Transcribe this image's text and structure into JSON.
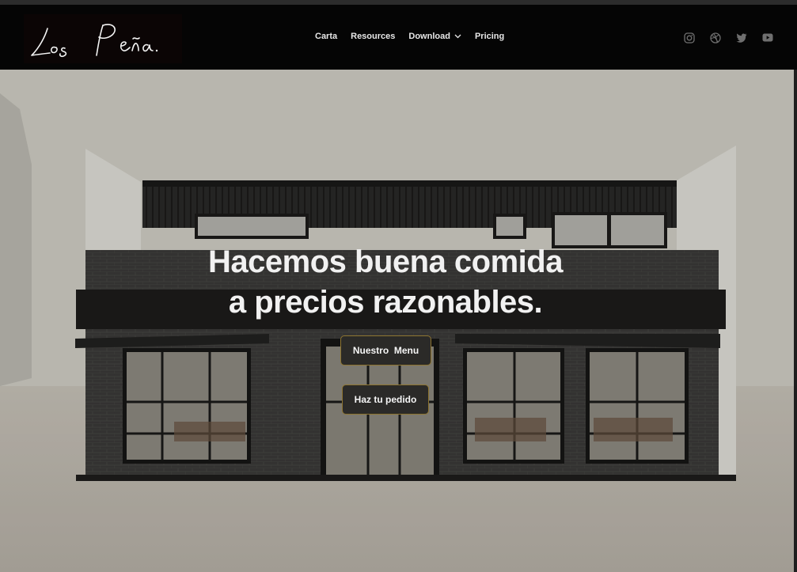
{
  "brand": {
    "logo_text": "Los Peña."
  },
  "nav": {
    "items": [
      {
        "label": "Carta"
      },
      {
        "label": "Resources"
      },
      {
        "label": "Download",
        "has_dropdown": true
      },
      {
        "label": "Pricing"
      }
    ]
  },
  "socials": [
    {
      "icon": "instagram-icon"
    },
    {
      "icon": "dribbble-icon"
    },
    {
      "icon": "twitter-icon"
    },
    {
      "icon": "youtube-icon"
    }
  ],
  "hero": {
    "headline_line1": "Hacemos buena comida",
    "headline_line2": "a precios razonables.",
    "primary_button": "Nuestro  Menu",
    "secondary_button": "Haz tu pedido"
  },
  "colors": {
    "navbar_bg": "#050505",
    "button_bg": "#2b2a28",
    "button_border": "#8d7430",
    "text_light": "#f1f1f1"
  }
}
